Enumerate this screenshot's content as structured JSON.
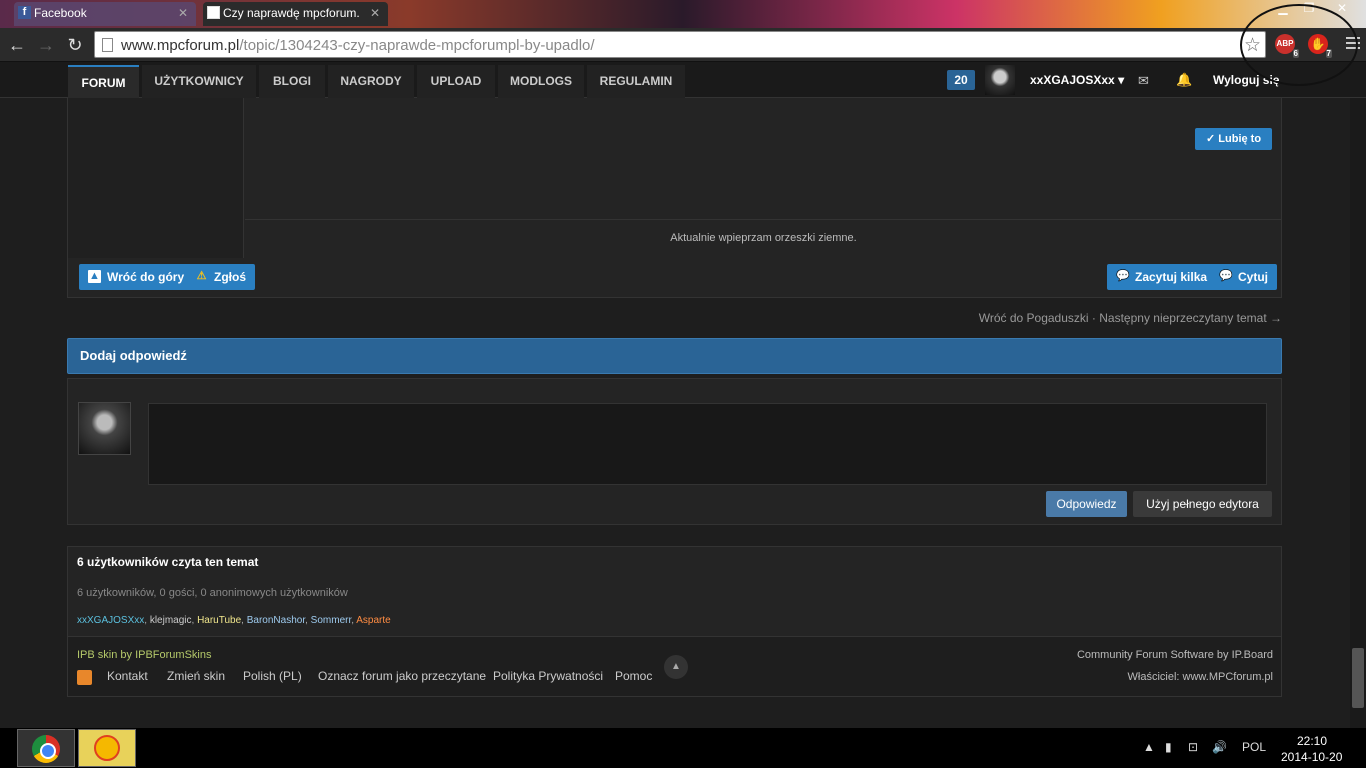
{
  "browser": {
    "tabs": [
      {
        "title": "Facebook",
        "icon": "facebook-icon"
      },
      {
        "title": "Czy naprawdę mpcforum.",
        "icon": "mpcforum-favicon"
      }
    ],
    "url_domain": "www.mpcforum.pl",
    "url_path": "/topic/1304243-czy-naprawde-mpcforumpl-by-upadlo/",
    "extensions": [
      {
        "name": "ABP",
        "count": "6"
      },
      {
        "name": "stop",
        "count": "7"
      }
    ]
  },
  "nav": {
    "items": [
      "FORUM",
      "UŻYTKOWNICY",
      "BLOGI",
      "NAGRODY",
      "UPLOAD",
      "MODLOGS",
      "REGULAMIN"
    ],
    "notif_count": "20",
    "username": "xxXGAJOSXxx",
    "logout": "Wyloguj się"
  },
  "post": {
    "like_label": "Lubię to",
    "signature": "Aktualnie wpieprzam orzeszki ziemne.",
    "back_top": "Wróć do góry",
    "report": "Zgłoś",
    "multi_quote": "Zacytuj kilka",
    "quote": "Cytuj"
  },
  "topic_nav": {
    "back": "Wróć do Pogaduszki",
    "sep": " · ",
    "next": "Następny nieprzeczytany temat →"
  },
  "reply": {
    "header": "Dodaj odpowiedź",
    "submit": "Odpowiedz",
    "full_editor": "Użyj pełnego edytora"
  },
  "readers": {
    "title": "6 użytkowników czyta ten temat",
    "stats": "6 użytkowników, 0 gości, 0 anonimowych użytkowników",
    "users": [
      {
        "name": "xxXGAJOSXxx",
        "color": "#5bc0de"
      },
      {
        "name": "klejmagic",
        "color": "#cccccc"
      },
      {
        "name": "HaruTube",
        "color": "#f0e68c"
      },
      {
        "name": "BaronNashor",
        "color": "#9ecbef"
      },
      {
        "name": "Sommerr",
        "color": "#9ecbef"
      },
      {
        "name": "Asparte",
        "color": "#ff8c42"
      }
    ]
  },
  "footer": {
    "skin": "IPB skin by IPBForumSkins",
    "links": [
      "Kontakt",
      "Zmień skin",
      "Polish (PL)",
      "Oznacz forum jako przeczytane",
      "Polityka Prywatności",
      "Pomoc"
    ],
    "software": "Community Forum Software by IP.Board",
    "owner": "Właściciel: www.MPCforum.pl"
  },
  "taskbar": {
    "language": "POL",
    "time": "22:10",
    "date": "2014-10-20"
  },
  "colors": {
    "accent": "#2a7fc1",
    "reply_header": "#2a6496"
  }
}
